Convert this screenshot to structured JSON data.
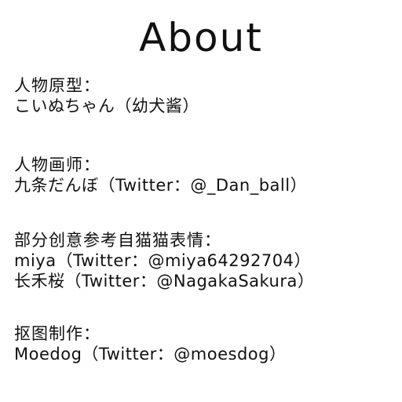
{
  "title": "About",
  "sections": {
    "original": {
      "label": "人物原型：",
      "lines": [
        "こいぬちゃん（幼犬酱）"
      ]
    },
    "artist": {
      "label": "人物画师：",
      "lines": [
        "九条だんぼ（Twitter：@_Dan_ball）"
      ]
    },
    "creative": {
      "label": "部分创意参考自猫猫表情：",
      "lines": [
        "miya（Twitter：@miya64292704）",
        "长禾桜（Twitter：@NagakaSakura）"
      ]
    },
    "cutout": {
      "label": "抠图制作：",
      "lines": [
        "Moedog（Twitter：@moesdog）"
      ]
    }
  }
}
